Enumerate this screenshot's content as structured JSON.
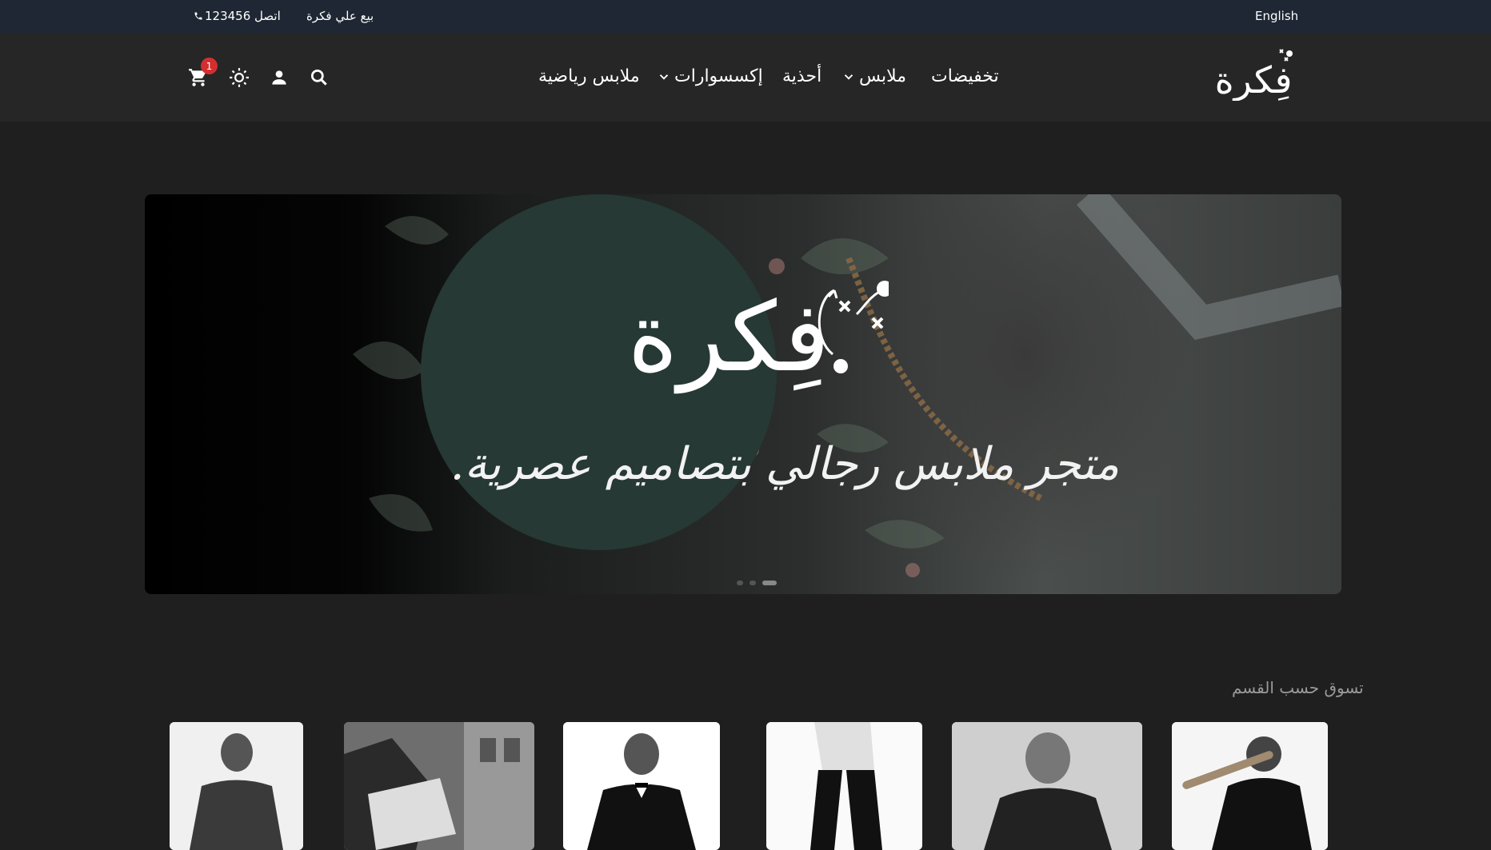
{
  "topbar": {
    "language_label": "English",
    "sell_label": "بيع علي فكرة",
    "contact_label": "اتصل 123456"
  },
  "header": {
    "logo_text": "فِكرة",
    "nav": [
      {
        "label": "تخفيضات",
        "has_dropdown": false
      },
      {
        "label": "ملابس",
        "has_dropdown": true
      },
      {
        "label": "أحذية",
        "has_dropdown": false
      },
      {
        "label": "إكسسوارات",
        "has_dropdown": true
      },
      {
        "label": "ملابس رياضية",
        "has_dropdown": false
      }
    ],
    "cart_count": "1",
    "icons": [
      "search-icon",
      "user-icon",
      "theme-toggle-icon",
      "cart-icon"
    ]
  },
  "hero": {
    "brand_text": "فِكرة",
    "tagline": "متجر ملابس رجالي بتصاميم عصرية.",
    "slide_count": 3,
    "active_slide": 2
  },
  "categories": {
    "title": "تسوق حسب القسم",
    "items": [
      "category-1",
      "category-2",
      "category-3",
      "category-4",
      "category-5",
      "category-6"
    ]
  },
  "colors": {
    "topbar_bg": "#1e2733",
    "nav_bg": "#262626",
    "page_bg": "#1f1f1f",
    "hero_circle": "#263934",
    "badge": "#d32f2f"
  }
}
